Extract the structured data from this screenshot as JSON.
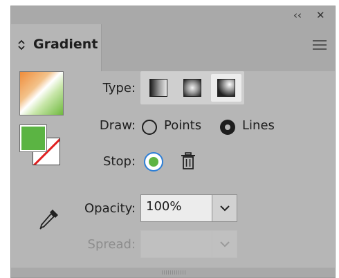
{
  "panel": {
    "tab_label": "Gradient",
    "icons": {
      "collapse": "double-chevron-left-icon",
      "close": "close-icon",
      "menu": "hamburger-menu-icon",
      "tab_toggle": "chevron-updown-icon"
    }
  },
  "gradient": {
    "type_label": "Type:",
    "type_options": [
      "linear-gradient-icon",
      "radial-gradient-icon",
      "freeform-gradient-icon"
    ],
    "type_selected": "freeform-gradient-icon",
    "draw_label": "Draw:",
    "draw_options": [
      "Points",
      "Lines"
    ],
    "draw_selected": "Lines",
    "stop_label": "Stop:",
    "stop_color": "#5fb443",
    "opacity_label": "Opacity:",
    "opacity_value": "100%",
    "spread_label": "Spread:",
    "spread_value": "",
    "swatch_colors": {
      "gradient_start": "#ef8c3a",
      "gradient_end": "#6fb93f",
      "fill": "#5bb443",
      "stroke": "none"
    }
  }
}
